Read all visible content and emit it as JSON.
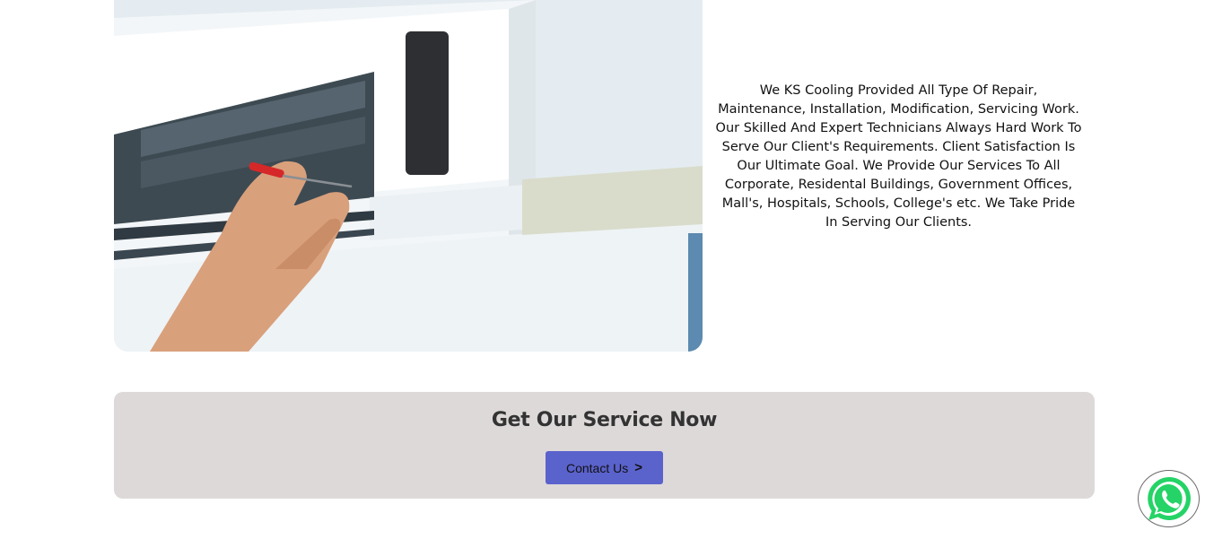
{
  "about": {
    "text": "We KS Cooling Provided All Type Of Repair, Maintenance, Installation, Modification, Servicing Work. Our Skilled And Expert Technicians Always Hard Work To Serve Our Client's Requirements. Client Satisfaction Is Our Ultimate Goal. We Provide Our Services To All Corporate, Residental Buildings, Government Offices, Mall's, Hospitals, Schools, College's etc. We Take Pride In Serving Our Clients."
  },
  "cta": {
    "title": "Get Our Service Now",
    "button_label": "Contact Us",
    "button_chevron": ">"
  },
  "hero": {
    "image_subject": "technician servicing air conditioner"
  },
  "floating": {
    "icon": "whatsapp-icon"
  },
  "colors": {
    "cta_background": "#ded9d9",
    "button": "#5a62cc",
    "whatsapp": "#25d366"
  }
}
